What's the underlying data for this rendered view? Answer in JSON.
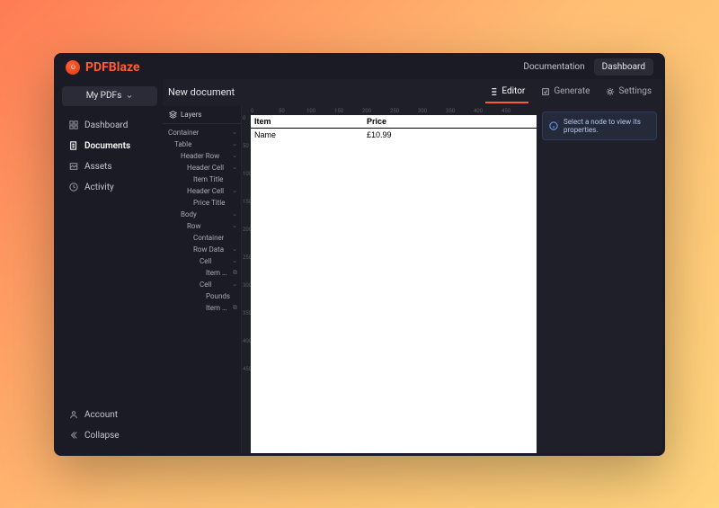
{
  "brand": "PDFBlaze",
  "top_links": {
    "docs": "Documentation",
    "dashboard": "Dashboard"
  },
  "sidebar": {
    "dropdown": "My PDFs",
    "items": [
      {
        "label": "Dashboard",
        "icon": "dashboard-icon"
      },
      {
        "label": "Documents",
        "icon": "documents-icon"
      },
      {
        "label": "Assets",
        "icon": "assets-icon"
      },
      {
        "label": "Activity",
        "icon": "activity-icon"
      }
    ],
    "bottom": [
      {
        "label": "Account",
        "icon": "user-icon"
      },
      {
        "label": "Collapse",
        "icon": "collapse-icon"
      }
    ]
  },
  "doc": {
    "title": "New document"
  },
  "tabs": {
    "editor": "Editor",
    "generate": "Generate",
    "settings": "Settings"
  },
  "layers": {
    "title": "Layers",
    "tree": [
      {
        "label": "Container",
        "indent": 0,
        "arrow": true
      },
      {
        "label": "Table",
        "indent": 1,
        "arrow": true
      },
      {
        "label": "Header Row",
        "indent": 2,
        "arrow": true
      },
      {
        "label": "Header Cell",
        "indent": 3,
        "arrow": true
      },
      {
        "label": "Item Title",
        "indent": 4,
        "arrow": false
      },
      {
        "label": "Header Cell",
        "indent": 3,
        "arrow": true
      },
      {
        "label": "Price Title",
        "indent": 4,
        "arrow": false
      },
      {
        "label": "Body",
        "indent": 2,
        "arrow": true
      },
      {
        "label": "Row",
        "indent": 3,
        "arrow": true
      },
      {
        "label": "Container",
        "indent": 4,
        "arrow": false
      },
      {
        "label": "Row Data",
        "indent": 4,
        "arrow": true
      },
      {
        "label": "Cell",
        "indent": 5,
        "arrow": true
      },
      {
        "label": "Item Name",
        "indent": 6,
        "arrow": false,
        "link": true
      },
      {
        "label": "Cell",
        "indent": 5,
        "arrow": true
      },
      {
        "label": "Pounds",
        "indent": 6,
        "arrow": false
      },
      {
        "label": "Item Price",
        "indent": 6,
        "arrow": false,
        "link": true
      }
    ]
  },
  "ruler_ticks": [
    "0",
    "50",
    "100",
    "150",
    "200",
    "250",
    "300",
    "350",
    "400",
    "450"
  ],
  "preview": {
    "headers": {
      "item": "Item",
      "price": "Price"
    },
    "rows": [
      {
        "item": "Name",
        "price": "£10.99"
      }
    ]
  },
  "properties_hint": "Select a node to view its properties."
}
